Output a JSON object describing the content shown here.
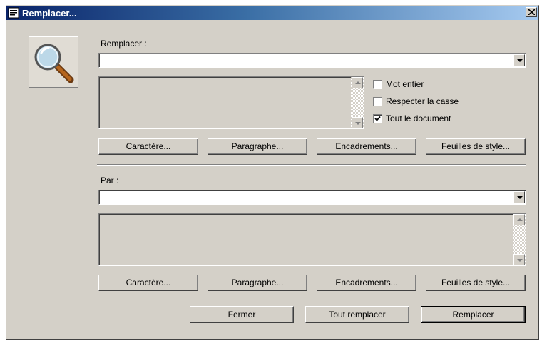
{
  "window": {
    "title": "Remplacer..."
  },
  "find": {
    "label": "Remplacer :",
    "value": "",
    "buttons": [
      "Caractère...",
      "Paragraphe...",
      "Encadrements...",
      "Feuilles de style..."
    ]
  },
  "options": [
    {
      "label": "Mot entier",
      "checked": false
    },
    {
      "label": "Respecter la casse",
      "checked": false
    },
    {
      "label": "Tout le document",
      "checked": true
    }
  ],
  "replace": {
    "label": "Par :",
    "value": "",
    "buttons": [
      "Caractère...",
      "Paragraphe...",
      "Encadrements...",
      "Feuilles de style..."
    ]
  },
  "actions": {
    "close": "Fermer",
    "replace_all": "Tout remplacer",
    "replace": "Remplacer"
  }
}
